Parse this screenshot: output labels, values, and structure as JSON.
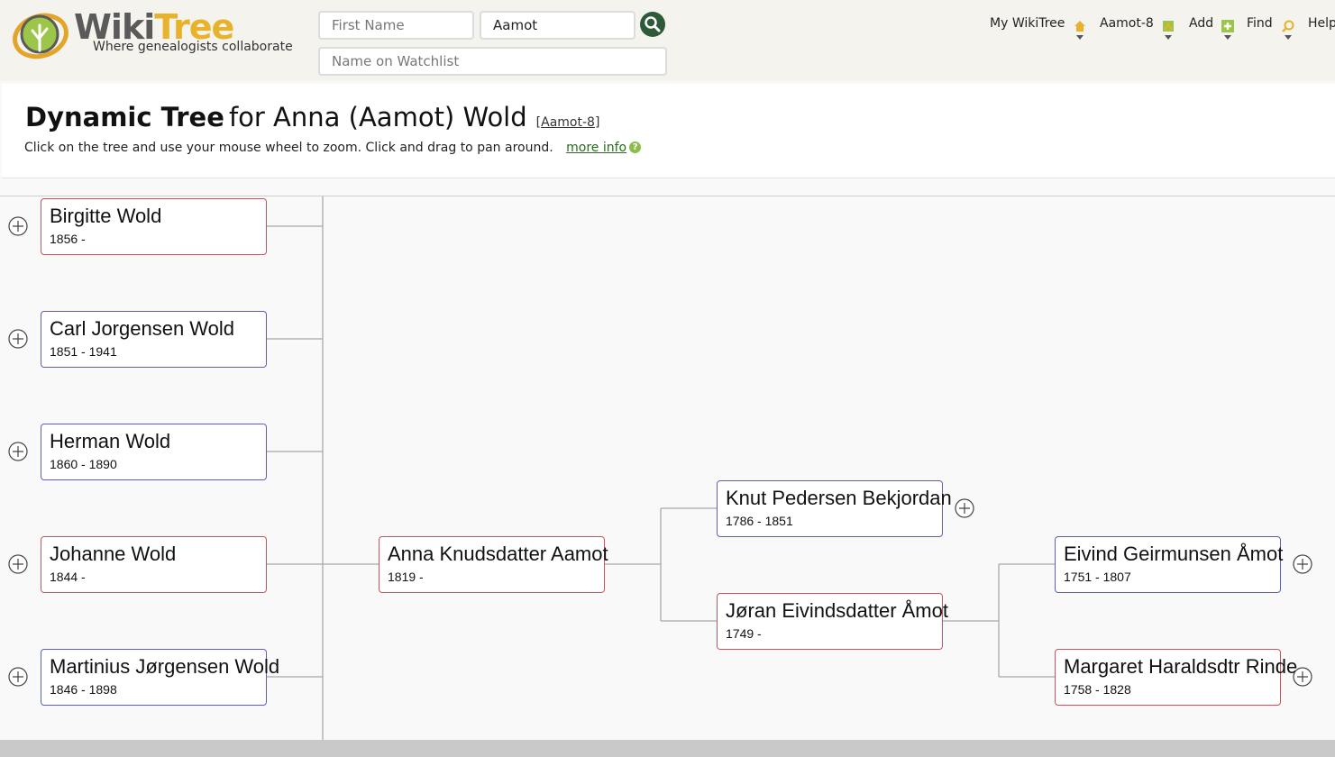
{
  "site": {
    "logo_word_a": "Wiki",
    "logo_word_b": "Tree",
    "tagline": "Where genealogists collaborate"
  },
  "search": {
    "first_name_placeholder": "First Name",
    "last_name_value": "Aamot",
    "watchlist_placeholder": "Name on Watchlist",
    "button_icon": "search-icon"
  },
  "nav": {
    "my_wikitree": "My WikiTree",
    "profile_id": "Aamot-8",
    "add": "Add",
    "find": "Find",
    "help": "Help",
    "icons": [
      "home-icon",
      "profile-icon",
      "add-icon",
      "find-icon"
    ]
  },
  "header": {
    "title_strong": "Dynamic Tree",
    "title_rest": "for Anna (Aamot) Wold",
    "id_open": "[",
    "id_link": "Aamot-8",
    "id_close": "]",
    "instructions": "Click on the tree and use your mouse wheel to zoom. Click and drag to pan around.",
    "more_info": "more info",
    "help_icon_text": "?"
  },
  "colors": {
    "female_border": "#c8545f",
    "male_border": "#5d5fc0",
    "connector": "#a9a9a9",
    "link_green": "#2a6a1f"
  },
  "tree": {
    "children": [
      {
        "name": "Birgitte Wold",
        "dates": "1856 -",
        "sex": "female"
      },
      {
        "name": "Carl Jorgensen Wold",
        "dates": "1851 - 1941",
        "sex": "male"
      },
      {
        "name": "Herman Wold",
        "dates": "1860 - 1890",
        "sex": "male"
      },
      {
        "name": "Johanne Wold",
        "dates": "1844 -",
        "sex": "female"
      },
      {
        "name": "Martinius Jørgensen Wold",
        "dates": "1846 - 1898",
        "sex": "male"
      }
    ],
    "focus": {
      "name": "Anna Knudsdatter Aamot",
      "dates": "1819 -",
      "sex": "female"
    },
    "father": {
      "name": "Knut Pedersen Bekjordan",
      "dates": "1786 - 1851",
      "sex": "male"
    },
    "mother": {
      "name": "Jøran Eivindsdatter Åmot",
      "dates": "1749 -",
      "sex": "female"
    },
    "maternal_grandfather": {
      "name": "Eivind Geirmunsen Åmot",
      "dates": "1751 - 1807",
      "sex": "male"
    },
    "maternal_grandmother": {
      "name": "Margaret Haraldsdtr Rinde",
      "dates": "1758 - 1828",
      "sex": "female"
    }
  }
}
